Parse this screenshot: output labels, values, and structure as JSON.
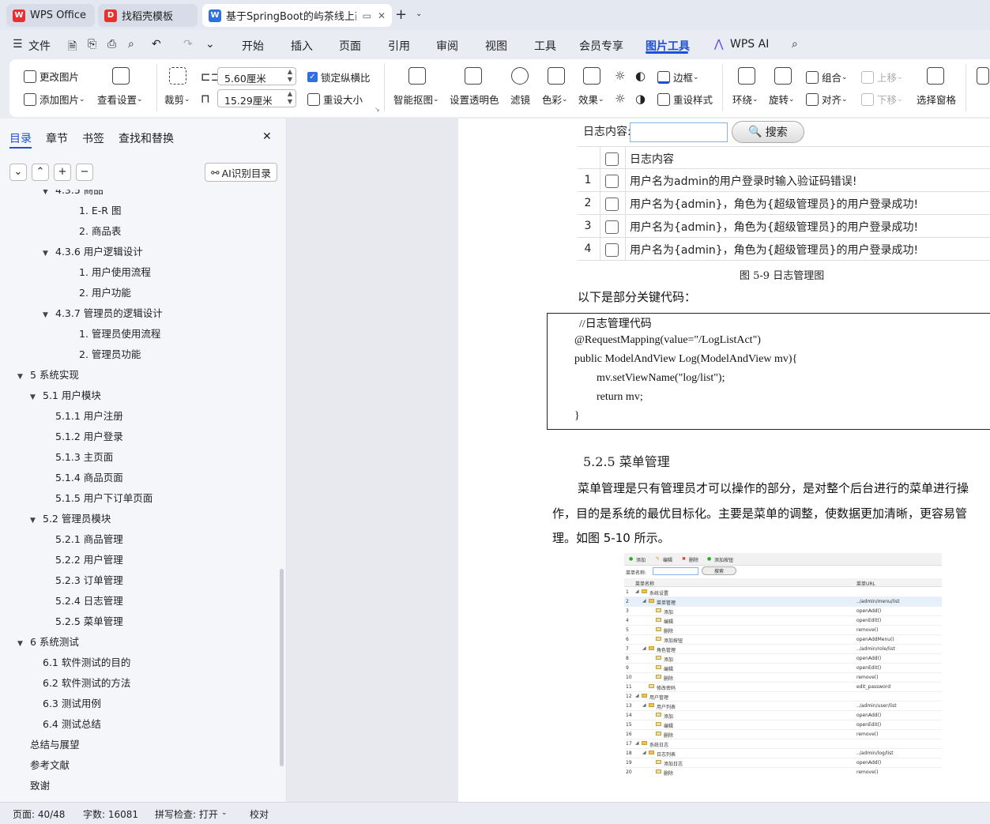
{
  "tabs": [
    {
      "label": "WPS Office",
      "icon": "wps-logo-icon",
      "color": "#e8312f"
    },
    {
      "label": "找稻壳模板",
      "icon": "docer-logo-icon",
      "color": "#e8312f"
    },
    {
      "label": "基于SpringBoot的屿茶线上商",
      "icon": "writer-icon",
      "color": "#2f6fe4"
    }
  ],
  "menu": {
    "file": "文件",
    "items": [
      "开始",
      "插入",
      "页面",
      "引用",
      "审阅",
      "视图",
      "工具",
      "会员专享",
      "图片工具",
      "WPS AI"
    ],
    "active": "图片工具"
  },
  "ribbon": {
    "change_picture": "更改图片",
    "add_picture": "添加图片",
    "view_settings": "查看设置",
    "crop": "裁剪",
    "width": "5.60厘米",
    "height": "15.29厘米",
    "lock_ratio": "锁定纵横比",
    "reset_size": "重设大小",
    "smart_cutout": "智能抠图",
    "set_transparent": "设置透明色",
    "filter": "滤镜",
    "color": "色彩",
    "effects": "效果",
    "border": "边框",
    "reset_style": "重设样式",
    "wrap": "环绕",
    "rotate": "旋转",
    "group": "组合",
    "align": "对齐",
    "bring_forward": "上移",
    "send_backward": "下移",
    "selection_pane": "选择窗格"
  },
  "nav": {
    "tabs": [
      "目录",
      "章节",
      "书签",
      "查找和替换"
    ],
    "ai_button": "AI识别目录",
    "toc": [
      {
        "label": "4.3.5  商品",
        "level": 2,
        "expanded": true
      },
      {
        "label": "1. E-R 图",
        "level": 3
      },
      {
        "label": "2.  商品表",
        "level": 3
      },
      {
        "label": "4.3.6  用户逻辑设计",
        "level": 2,
        "expanded": true
      },
      {
        "label": "1.  用户使用流程",
        "level": 3
      },
      {
        "label": "2.  用户功能",
        "level": 3
      },
      {
        "label": "4.3.7  管理员的逻辑设计",
        "level": 2,
        "expanded": true
      },
      {
        "label": "1.  管理员使用流程",
        "level": 3
      },
      {
        "label": "2.  管理员功能",
        "level": 3
      },
      {
        "label": "5  系统实现",
        "level": 0,
        "expanded": true
      },
      {
        "label": "5.1  用户模块",
        "level": 1,
        "expanded": true
      },
      {
        "label": "5.1.1  用户注册",
        "level": 2
      },
      {
        "label": "5.1.2  用户登录",
        "level": 2
      },
      {
        "label": "5.1.3  主页面",
        "level": 2
      },
      {
        "label": "5.1.4  商品页面",
        "level": 2
      },
      {
        "label": "5.1.5  用户下订单页面",
        "level": 2
      },
      {
        "label": "5.2  管理员模块",
        "level": 1,
        "expanded": true
      },
      {
        "label": "5.2.1  商品管理",
        "level": 2
      },
      {
        "label": "5.2.2  用户管理",
        "level": 2
      },
      {
        "label": "5.2.3  订单管理",
        "level": 2
      },
      {
        "label": "5.2.4  日志管理",
        "level": 2
      },
      {
        "label": "5.2.5  菜单管理",
        "level": 2
      },
      {
        "label": "6  系统测试",
        "level": 0,
        "expanded": true
      },
      {
        "label": "6.1  软件测试的目的",
        "level": 1
      },
      {
        "label": "6.2  软件测试的方法",
        "level": 1
      },
      {
        "label": "6.3  测试用例",
        "level": 1
      },
      {
        "label": "6.4  测试总结",
        "level": 1
      },
      {
        "label": "总结与展望",
        "level": 0
      },
      {
        "label": "参考文献",
        "level": 0
      },
      {
        "label": "致谢",
        "level": 0
      }
    ]
  },
  "doc": {
    "search_label": "日志内容:",
    "search_button": "搜索",
    "log_header": "日志内容",
    "log_rows": [
      {
        "n": "1",
        "text": "用户名为admin的用户登录时输入验证码错误!"
      },
      {
        "n": "2",
        "text": "用户名为{admin}，角色为{超级管理员}的用户登录成功!"
      },
      {
        "n": "3",
        "text": "用户名为{admin}，角色为{超级管理员}的用户登录成功!"
      },
      {
        "n": "4",
        "text": "用户名为{admin}，角色为{超级管理员}的用户登录成功!"
      }
    ],
    "figure_caption_1": "图 5-9 日志管理图",
    "intro_text": "以下是部分关键代码：",
    "code_lines": [
      "//日志管理代码",
      "@RequestMapping(value=\"/LogListAct\")",
      "public ModelAndView Log(ModelAndView mv){",
      "mv.setViewName(\"log/list\");",
      "return mv;",
      "}"
    ],
    "heading": "5.2.5  菜单管理",
    "body_lines": [
      "菜单管理是只有管理员才可以操作的部分，是对整个后台进行的菜单进行操",
      "作，目的是系统的最优目标化。主要是菜单的调整，使数据更加清晰，更容易管",
      "理。如图 5-10 所示。"
    ],
    "figure": {
      "toolbar": [
        "添加",
        "编辑",
        "删除",
        "添加按钮"
      ],
      "search_label": "菜单名称:",
      "search_button": "搜索",
      "col_name": "菜单名称",
      "col_url": "菜单URL",
      "rows": [
        {
          "n": "1",
          "indent": 0,
          "name": "系统设置",
          "url": ""
        },
        {
          "n": "2",
          "indent": 1,
          "name": "菜单管理",
          "url": "../admin/menu/list"
        },
        {
          "n": "3",
          "indent": 2,
          "name": "添加",
          "url": "openAdd()"
        },
        {
          "n": "4",
          "indent": 2,
          "name": "编辑",
          "url": "openEdit()"
        },
        {
          "n": "5",
          "indent": 2,
          "name": "删除",
          "url": "remove()"
        },
        {
          "n": "6",
          "indent": 2,
          "name": "添加按钮",
          "url": "openAddMenu()"
        },
        {
          "n": "7",
          "indent": 1,
          "name": "角色管理",
          "url": "../admin/role/list"
        },
        {
          "n": "8",
          "indent": 2,
          "name": "添加",
          "url": "openAdd()"
        },
        {
          "n": "9",
          "indent": 2,
          "name": "编辑",
          "url": "openEdit()"
        },
        {
          "n": "10",
          "indent": 2,
          "name": "删除",
          "url": "remove()"
        },
        {
          "n": "11",
          "indent": 1,
          "name": "修改密码",
          "url": "edit_password"
        },
        {
          "n": "12",
          "indent": 0,
          "name": "用户管理",
          "url": ""
        },
        {
          "n": "13",
          "indent": 1,
          "name": "用户列表",
          "url": "../admin/user/list"
        },
        {
          "n": "14",
          "indent": 2,
          "name": "添加",
          "url": "openAdd()"
        },
        {
          "n": "15",
          "indent": 2,
          "name": "编辑",
          "url": "openEdit()"
        },
        {
          "n": "16",
          "indent": 2,
          "name": "删除",
          "url": "remove()"
        },
        {
          "n": "17",
          "indent": 0,
          "name": "系统日志",
          "url": ""
        },
        {
          "n": "18",
          "indent": 1,
          "name": "日志列表",
          "url": "../admin/log/list"
        },
        {
          "n": "19",
          "indent": 2,
          "name": "添加日志",
          "url": "openAdd()"
        },
        {
          "n": "20",
          "indent": 2,
          "name": "删除",
          "url": "remove()"
        }
      ]
    }
  },
  "status": {
    "page": "页面: 40/48",
    "words": "字数: 16081",
    "spell": "拼写检查: 打开",
    "proof": "校对"
  }
}
